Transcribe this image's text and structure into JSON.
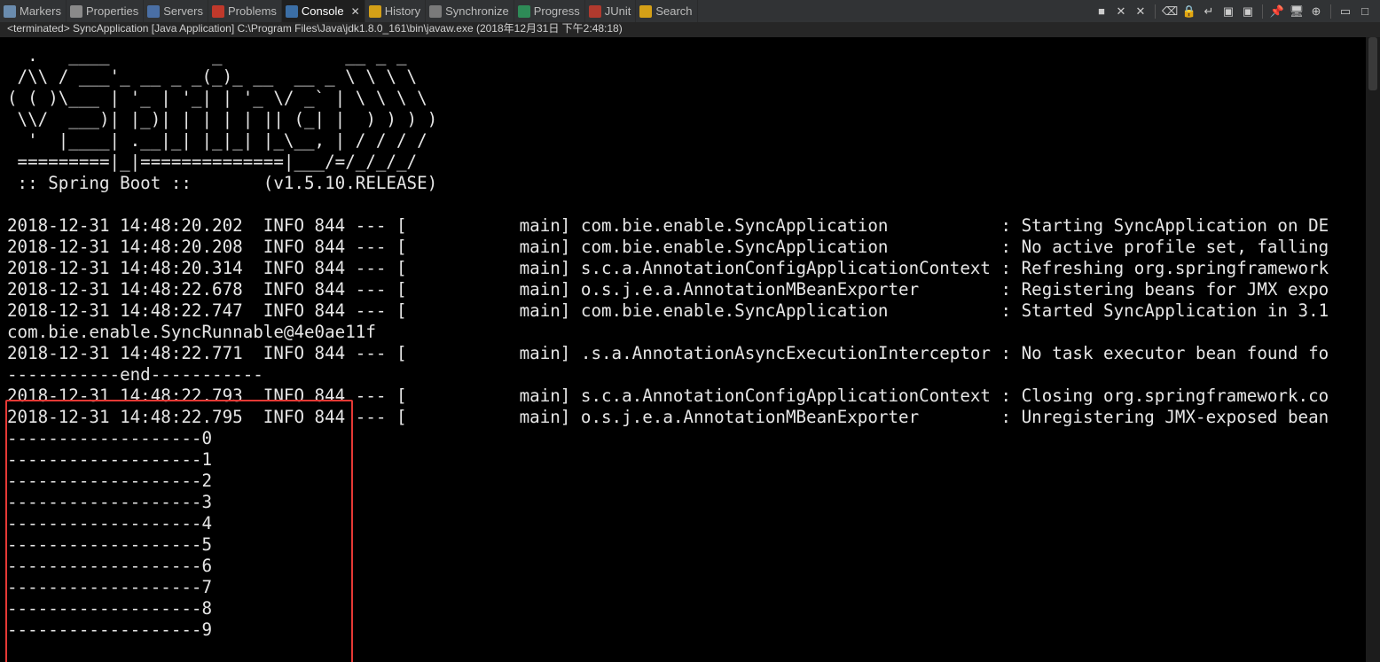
{
  "tabs": [
    {
      "label": "Markers",
      "icon": "markers-icon",
      "color": "#6a8caf",
      "active": false
    },
    {
      "label": "Properties",
      "icon": "properties-icon",
      "color": "#8a8a8a",
      "active": false
    },
    {
      "label": "Servers",
      "icon": "servers-icon",
      "color": "#4a6fa5",
      "active": false
    },
    {
      "label": "Problems",
      "icon": "problems-icon",
      "color": "#c0392b",
      "active": false
    },
    {
      "label": "Console",
      "icon": "console-icon",
      "color": "#3b6ea5",
      "active": true
    },
    {
      "label": "History",
      "icon": "history-icon",
      "color": "#d4a017",
      "active": false
    },
    {
      "label": "Synchronize",
      "icon": "synchronize-icon",
      "color": "#7a7a7a",
      "active": false
    },
    {
      "label": "Progress",
      "icon": "progress-icon",
      "color": "#2e8b57",
      "active": false
    },
    {
      "label": "JUnit",
      "icon": "junit-icon",
      "color": "#b03a2e",
      "active": false
    },
    {
      "label": "Search",
      "icon": "search-icon",
      "color": "#d4a017",
      "active": false
    }
  ],
  "toolbar": {
    "buttons": [
      {
        "name": "terminate-icon",
        "glyph": "■"
      },
      {
        "name": "remove-launch-icon",
        "glyph": "✕"
      },
      {
        "name": "remove-all-terminated-icon",
        "glyph": "✕"
      },
      {
        "name": "clear-console-icon",
        "glyph": "⌫"
      },
      {
        "name": "scroll-lock-icon",
        "glyph": "🔒"
      },
      {
        "name": "word-wrap-icon",
        "glyph": "↵"
      },
      {
        "name": "show-on-stdout-icon",
        "glyph": "▣"
      },
      {
        "name": "show-on-stderr-icon",
        "glyph": "▣"
      },
      {
        "name": "pin-console-icon",
        "glyph": "📌"
      },
      {
        "name": "display-console-icon",
        "glyph": "🖥"
      },
      {
        "name": "open-console-icon",
        "glyph": "⊕"
      },
      {
        "name": "minimize-icon",
        "glyph": "▭"
      },
      {
        "name": "maximize-icon",
        "glyph": "□"
      }
    ]
  },
  "status_line": "<terminated> SyncApplication [Java Application] C:\\Program Files\\Java\\jdk1.8.0_161\\bin\\javaw.exe (2018年12月31日 下午2:48:18)",
  "banner": [
    "  .   ____          _            __ _ _",
    " /\\\\ / ___'_ __ _ _(_)_ __  __ _ \\ \\ \\ \\",
    "( ( )\\___ | '_ | '_| | '_ \\/ _` | \\ \\ \\ \\",
    " \\\\/  ___)| |_)| | | | | || (_| |  ) ) ) )",
    "  '  |____| .__|_| |_|_| |_\\__, | / / / /",
    " =========|_|==============|___/=/_/_/_/",
    " :: Spring Boot ::       (v1.5.10.RELEASE)"
  ],
  "log_lines": [
    "",
    "2018-12-31 14:48:20.202  INFO 844 --- [           main] com.bie.enable.SyncApplication           : Starting SyncApplication on DE",
    "2018-12-31 14:48:20.208  INFO 844 --- [           main] com.bie.enable.SyncApplication           : No active profile set, falling",
    "2018-12-31 14:48:20.314  INFO 844 --- [           main] s.c.a.AnnotationConfigApplicationContext : Refreshing org.springframework",
    "2018-12-31 14:48:22.678  INFO 844 --- [           main] o.s.j.e.a.AnnotationMBeanExporter        : Registering beans for JMX expo",
    "2018-12-31 14:48:22.747  INFO 844 --- [           main] com.bie.enable.SyncApplication           : Started SyncApplication in 3.1",
    "com.bie.enable.SyncRunnable@4e0ae11f",
    "2018-12-31 14:48:22.771  INFO 844 --- [           main] .s.a.AnnotationAsyncExecutionInterceptor : No task executor bean found fo",
    "-----------end-----------",
    "2018-12-31 14:48:22.793  INFO 844 --- [           main] s.c.a.AnnotationConfigApplicationContext : Closing org.springframework.co",
    "2018-12-31 14:48:22.795  INFO 844 --- [           main] o.s.j.e.a.AnnotationMBeanExporter        : Unregistering JMX-exposed bean",
    "-------------------0",
    "-------------------1",
    "-------------------2",
    "-------------------3",
    "-------------------4",
    "-------------------5",
    "-------------------6",
    "-------------------7",
    "-------------------8",
    "-------------------9"
  ],
  "highlight_color": "#e53935"
}
